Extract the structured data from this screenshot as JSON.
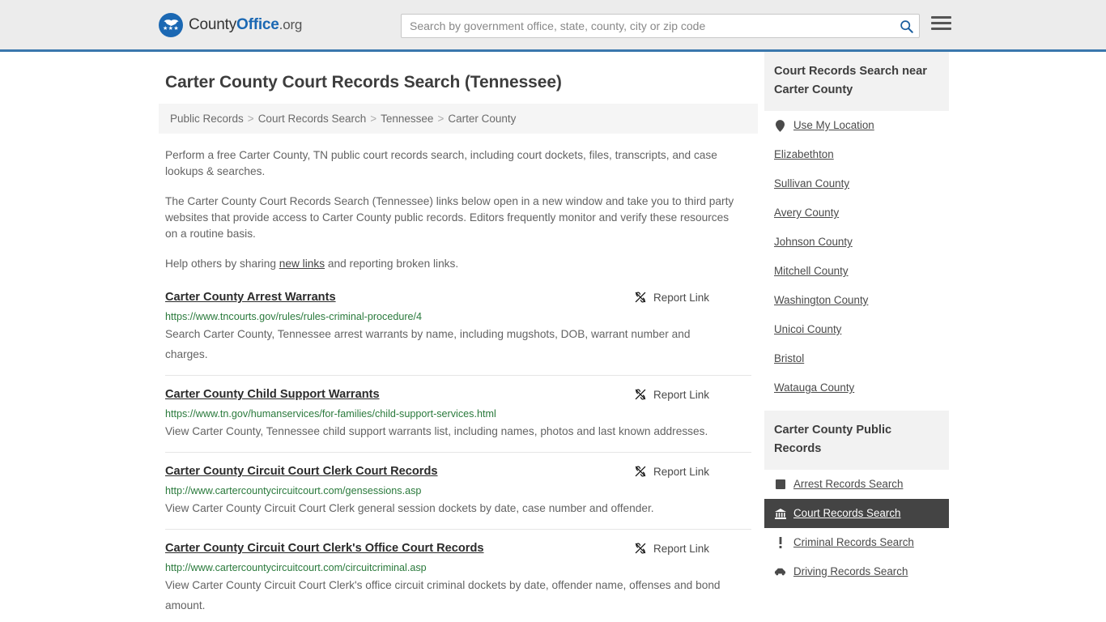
{
  "header": {
    "logo": {
      "prefix": "County",
      "bold": "Office",
      "suffix": ".org",
      "icon": "eagle-seal-icon"
    },
    "search": {
      "placeholder": "Search by government office, state, county, city or zip code",
      "value": "",
      "button_icon": "search-icon"
    },
    "menu_icon": "hamburger-menu-icon",
    "accent_color": "#3a77ad",
    "background_color": "#ececec"
  },
  "page": {
    "title": "Carter County Court Records Search (Tennessee)"
  },
  "breadcrumb": {
    "items": [
      "Public Records",
      "Court Records Search",
      "Tennessee",
      "Carter County"
    ],
    "separator": ">"
  },
  "intro": {
    "p1": "Perform a free Carter County, TN public court records search, including court dockets, files, transcripts, and case lookups & searches.",
    "p2": "The Carter County Court Records Search (Tennessee) links below open in a new window and take you to third party websites that provide access to Carter County public records. Editors frequently monitor and verify these resources on a routine basis.",
    "p3_before": "Help others by sharing ",
    "p3_link": "new links",
    "p3_after": " and reporting broken links."
  },
  "report_link_label": "Report Link",
  "report_link_icon": "broken-link-icon",
  "results": [
    {
      "title": "Carter County Arrest Warrants",
      "url": "https://www.tncourts.gov/rules/rules-criminal-procedure/4",
      "description": "Search Carter County, Tennessee arrest warrants by name, including mugshots, DOB, warrant number and charges."
    },
    {
      "title": "Carter County Child Support Warrants",
      "url": "https://www.tn.gov/humanservices/for-families/child-support-services.html",
      "description": "View Carter County, Tennessee child support warrants list, including names, photos and last known addresses."
    },
    {
      "title": "Carter County Circuit Court Clerk Court Records",
      "url": "http://www.cartercountycircuitcourt.com/gensessions.asp",
      "description": "View Carter County Circuit Court Clerk general session dockets by date, case number and offender."
    },
    {
      "title": "Carter County Circuit Court Clerk's Office Court Records",
      "url": "http://www.cartercountycircuitcourt.com/circuitcriminal.asp",
      "description": "View Carter County Circuit Court Clerk's office circuit criminal dockets by date, offender name, offenses and bond amount."
    }
  ],
  "sidebar": {
    "nearby": {
      "heading": "Court Records Search near Carter County",
      "items": [
        {
          "label": "Use My Location",
          "icon": "map-pin-icon"
        },
        {
          "label": "Elizabethton",
          "icon": ""
        },
        {
          "label": "Sullivan County",
          "icon": ""
        },
        {
          "label": "Avery County",
          "icon": ""
        },
        {
          "label": "Johnson County",
          "icon": ""
        },
        {
          "label": "Mitchell County",
          "icon": ""
        },
        {
          "label": "Washington County",
          "icon": ""
        },
        {
          "label": "Unicoi County",
          "icon": ""
        },
        {
          "label": "Bristol",
          "icon": ""
        },
        {
          "label": "Watauga County",
          "icon": ""
        }
      ]
    },
    "public_records": {
      "heading": "Carter County Public Records",
      "active_color": "#444444",
      "items": [
        {
          "label": "Arrest Records Search",
          "icon": "filled-square-icon",
          "active": false
        },
        {
          "label": "Court Records Search",
          "icon": "courthouse-icon",
          "active": true
        },
        {
          "label": "Criminal Records Search",
          "icon": "exclamation-icon",
          "active": false
        },
        {
          "label": "Driving Records Search",
          "icon": "car-icon",
          "active": false
        }
      ]
    }
  }
}
